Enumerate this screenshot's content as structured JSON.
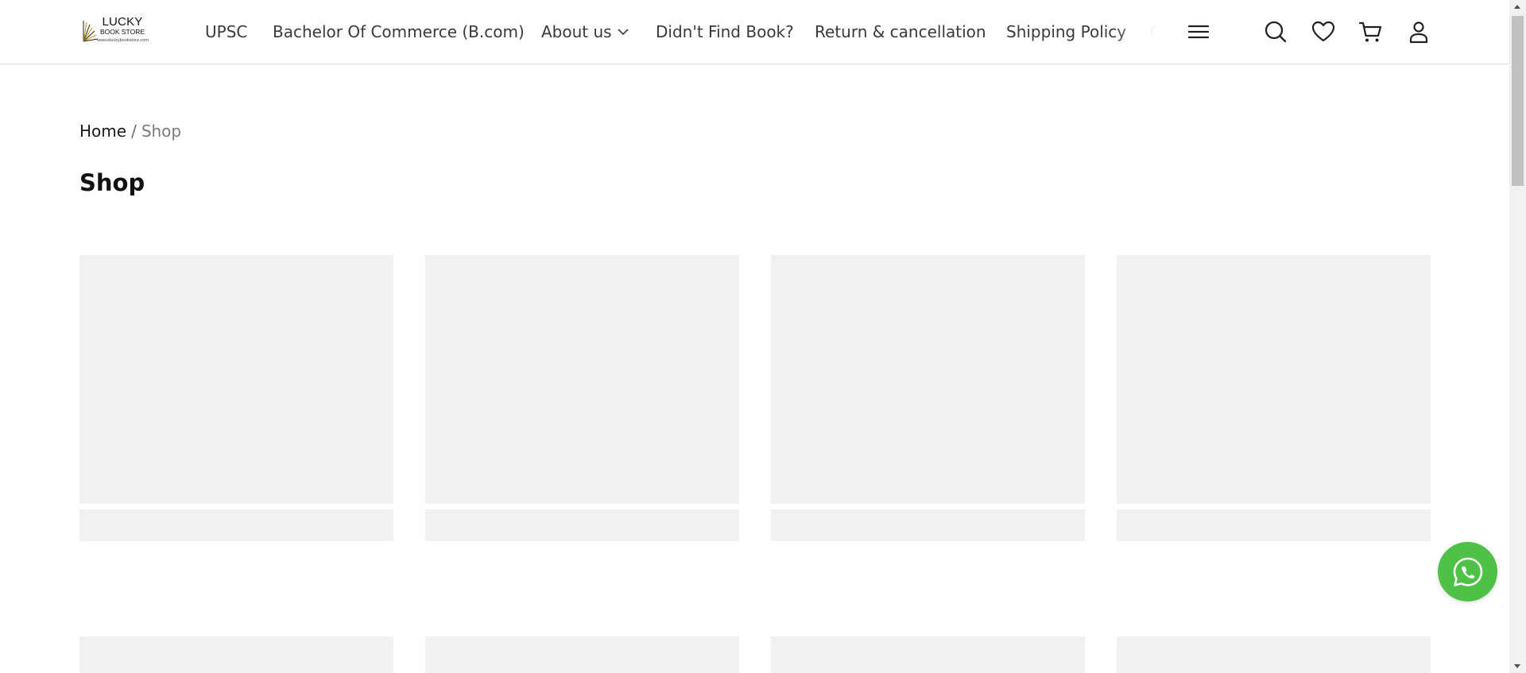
{
  "brand": {
    "line1": "LUCKY",
    "line2": "BOOK STORE",
    "line3": "www.eluckybookstore.com"
  },
  "nav": {
    "items": [
      {
        "label": "UPSC"
      },
      {
        "label": "Bachelor Of Commerce (B.com)"
      },
      {
        "label": "About us"
      },
      {
        "label": "Didn't Find Book?"
      },
      {
        "label": "Return & cancellation"
      },
      {
        "label": "Shipping Policy"
      },
      {
        "label": "GA"
      }
    ]
  },
  "header_icons": [
    "menu-icon",
    "search-icon",
    "heart-icon",
    "cart-icon",
    "user-icon"
  ],
  "breadcrumb": {
    "home": "Home",
    "separator": "/",
    "current": "Shop"
  },
  "page": {
    "title": "Shop"
  },
  "colors": {
    "skeleton": "#f1f1f1",
    "whatsapp": "#4dc247",
    "text": "#1a1a1a",
    "muted": "#7a7a7a"
  }
}
